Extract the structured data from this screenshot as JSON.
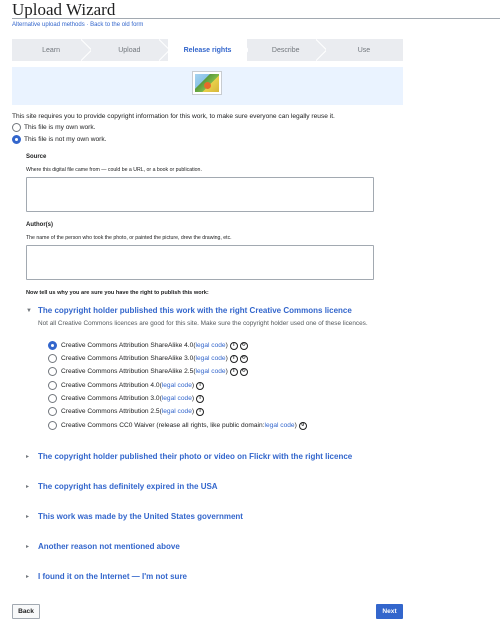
{
  "header": {
    "title": "Upload Wizard",
    "alt_link_1": "Alternative upload methods",
    "separator": " · ",
    "alt_link_2": "Back to the old form"
  },
  "steps": [
    {
      "label": "Learn",
      "active": false
    },
    {
      "label": "Upload",
      "active": false
    },
    {
      "label": "Release rights",
      "active": true
    },
    {
      "label": "Describe",
      "active": false
    },
    {
      "label": "Use",
      "active": false
    }
  ],
  "intro": "This site requires you to provide copyright information for this work, to make sure everyone can legally reuse it.",
  "ownership": {
    "own_work": "This file is my own work.",
    "not_own_work": "This file is not my own work.",
    "selected": "not_own_work"
  },
  "source": {
    "label": "Source",
    "help": "Where this digital file came from — could be a URL, or a book or publication.",
    "value": ""
  },
  "authors": {
    "label": "Author(s)",
    "help": "The name of the person who took the photo, or painted the picture, drew the drawing, etc.",
    "value": ""
  },
  "reason_prompt": "Now tell us why you are sure you have the right to publish this work:",
  "sections": [
    {
      "title": "The copyright holder published this work with the right Creative Commons licence",
      "expanded": true
    },
    {
      "title": "The copyright holder published their photo or video on Flickr with the right licence",
      "expanded": false
    },
    {
      "title": "The copyright has definitely expired in the USA",
      "expanded": false
    },
    {
      "title": "This work was made by the United States government",
      "expanded": false
    },
    {
      "title": "Another reason not mentioned above",
      "expanded": false
    },
    {
      "title": "I found it on the Internet — I'm not sure",
      "expanded": false
    }
  ],
  "section_note": "Not all Creative Commons licences are good for this site. Make sure the copyright holder used one of these licences.",
  "licenses": [
    {
      "label": "Creative Commons Attribution ShareAlike 4.0",
      "open": " (",
      "link": "legal code",
      "close": ")",
      "selected": true
    },
    {
      "label": "Creative Commons Attribution ShareAlike 3.0",
      "open": " (",
      "link": "legal code",
      "close": ")",
      "selected": false
    },
    {
      "label": "Creative Commons Attribution ShareAlike 2.5",
      "open": " (",
      "link": "legal code",
      "close": ")",
      "selected": false
    },
    {
      "label": "Creative Commons Attribution 4.0",
      "open": " (",
      "link": "legal code",
      "close": ")",
      "selected": false
    },
    {
      "label": "Creative Commons Attribution 3.0",
      "open": " (",
      "link": "legal code",
      "close": ")",
      "selected": false
    },
    {
      "label": "Creative Commons Attribution 2.5",
      "open": " (",
      "link": "legal code",
      "close": ")",
      "selected": false
    },
    {
      "label": "Creative Commons CC0 Waiver (release all rights, like public domain:",
      "open": " ",
      "link": "legal code",
      "close": ")",
      "selected": false
    }
  ],
  "icons": {
    "by": "i",
    "sa": "↻",
    "zero": "0"
  },
  "buttons": {
    "back": "Back",
    "next": "Next"
  },
  "colors": {
    "link": "#3366cc",
    "primary_button": "#3366cc",
    "preview_bg": "#eaf3ff",
    "steps_bg": "#eaecf0"
  }
}
